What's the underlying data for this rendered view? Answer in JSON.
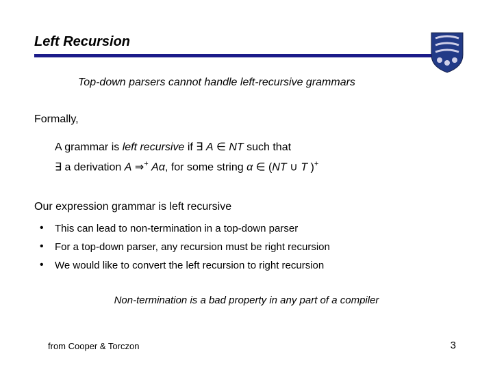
{
  "slide": {
    "title": "Left Recursion",
    "subtitle": "Top-down parsers cannot handle left-recursive grammars",
    "formally": "Formally,",
    "def1_a": "A grammar is ",
    "def1_b": "left recursive",
    "def1_c": " if ∃ ",
    "def1_d": "A",
    "def1_e": " ∈ ",
    "def1_f": "NT",
    "def1_g": " such that",
    "def2_a": "∃ a derivation ",
    "def2_b": "A",
    "def2_c": " ⇒",
    "def2_sup1": "+",
    "def2_d": " ",
    "def2_e": "Aα",
    "def2_f": ", for some string ",
    "def2_g": "α",
    "def2_h": " ∈ (",
    "def2_i": "NT",
    "def2_j": " ∪ ",
    "def2_k": "T",
    "def2_l": " )",
    "def2_sup2": "+",
    "statement": "Our expression grammar is left recursive",
    "bullets": [
      "This can lead to non-termination in a top-down parser",
      "For a top-down parser, any recursion must be right recursion",
      "We would like to convert the left recursion to right recursion"
    ],
    "footer_note": "Non-termination is a bad property in any part of a compiler",
    "citation": "from Cooper & Torczon",
    "page": "3"
  },
  "colors": {
    "underline": "#1b1b8a",
    "shield_main": "#223a87",
    "shield_accent": "#cfcfe8"
  }
}
